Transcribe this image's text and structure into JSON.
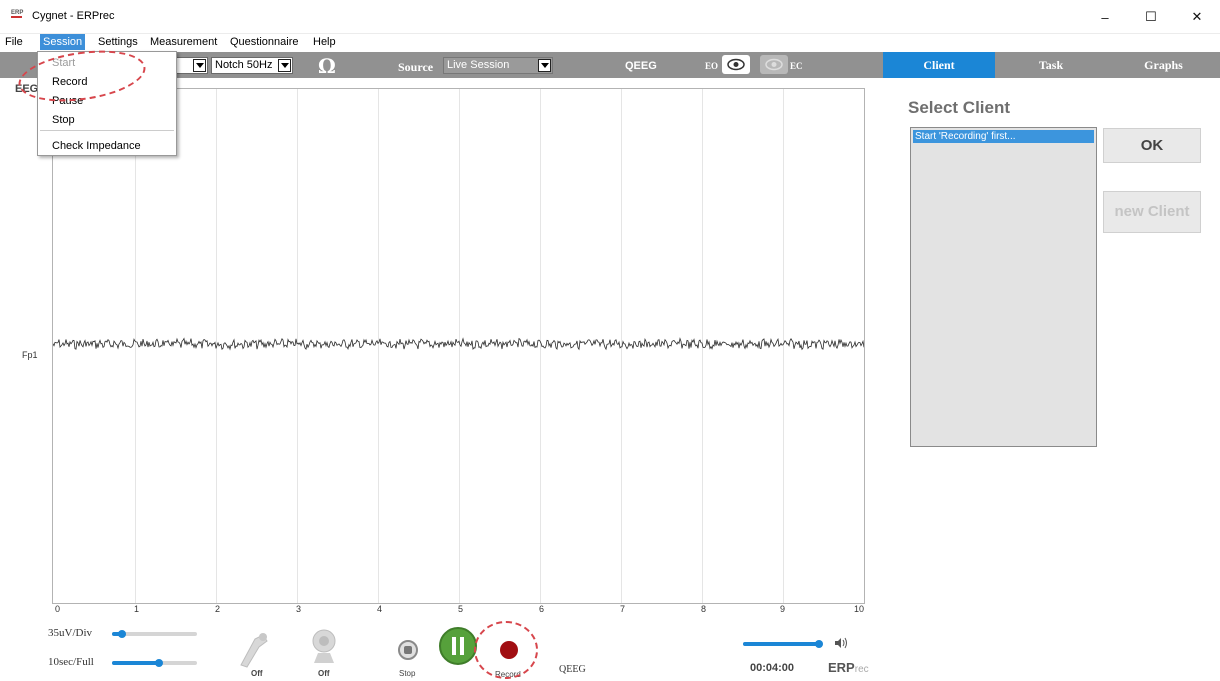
{
  "window": {
    "logo_text": "ERP",
    "title": "Cygnet - ERPrec",
    "minimize": "–",
    "maximize": "☐",
    "close": "✕"
  },
  "menu": [
    "File",
    "Session",
    "Settings",
    "Measurement",
    "Questionnaire",
    "Help"
  ],
  "session_menu": {
    "items": [
      "Start",
      "Record",
      "Pause",
      "Stop",
      "Check Impedance"
    ]
  },
  "toolbar": {
    "notch": "Notch 50Hz",
    "impedance_symbol": "Ω",
    "source_label": "Source",
    "source_value": "Live Session",
    "qeeg": "QEEG",
    "eo": "EO",
    "ec": "EC"
  },
  "tabs": [
    "Client",
    "Task",
    "Graphs"
  ],
  "eeg": {
    "label": "EEG",
    "channel": "Fp1",
    "x_ticks": [
      "0",
      "1",
      "2",
      "3",
      "4",
      "5",
      "6",
      "7",
      "8",
      "9",
      "10"
    ]
  },
  "client_panel": {
    "title": "Select Client",
    "list_item": "Start 'Recording' first...",
    "ok": "OK",
    "new_client": "new Client"
  },
  "bottom": {
    "scale_label": "35uV/Div",
    "time_label": "10sec/Full",
    "device_off_1": "Off",
    "device_off_2": "Off",
    "stop": "Stop",
    "record": "Record",
    "qeeg": "QEEG",
    "timer": "00:04:00",
    "brand_main": "ERP",
    "brand_sub": "rec",
    "volume_level": 0.95,
    "scale_level": 0.12,
    "time_level": 0.55
  },
  "colors": {
    "accent": "#1b86d6",
    "toolbar": "#919191",
    "annotation": "#d7464c",
    "pause": "#56a13b",
    "record": "#a10e12"
  }
}
